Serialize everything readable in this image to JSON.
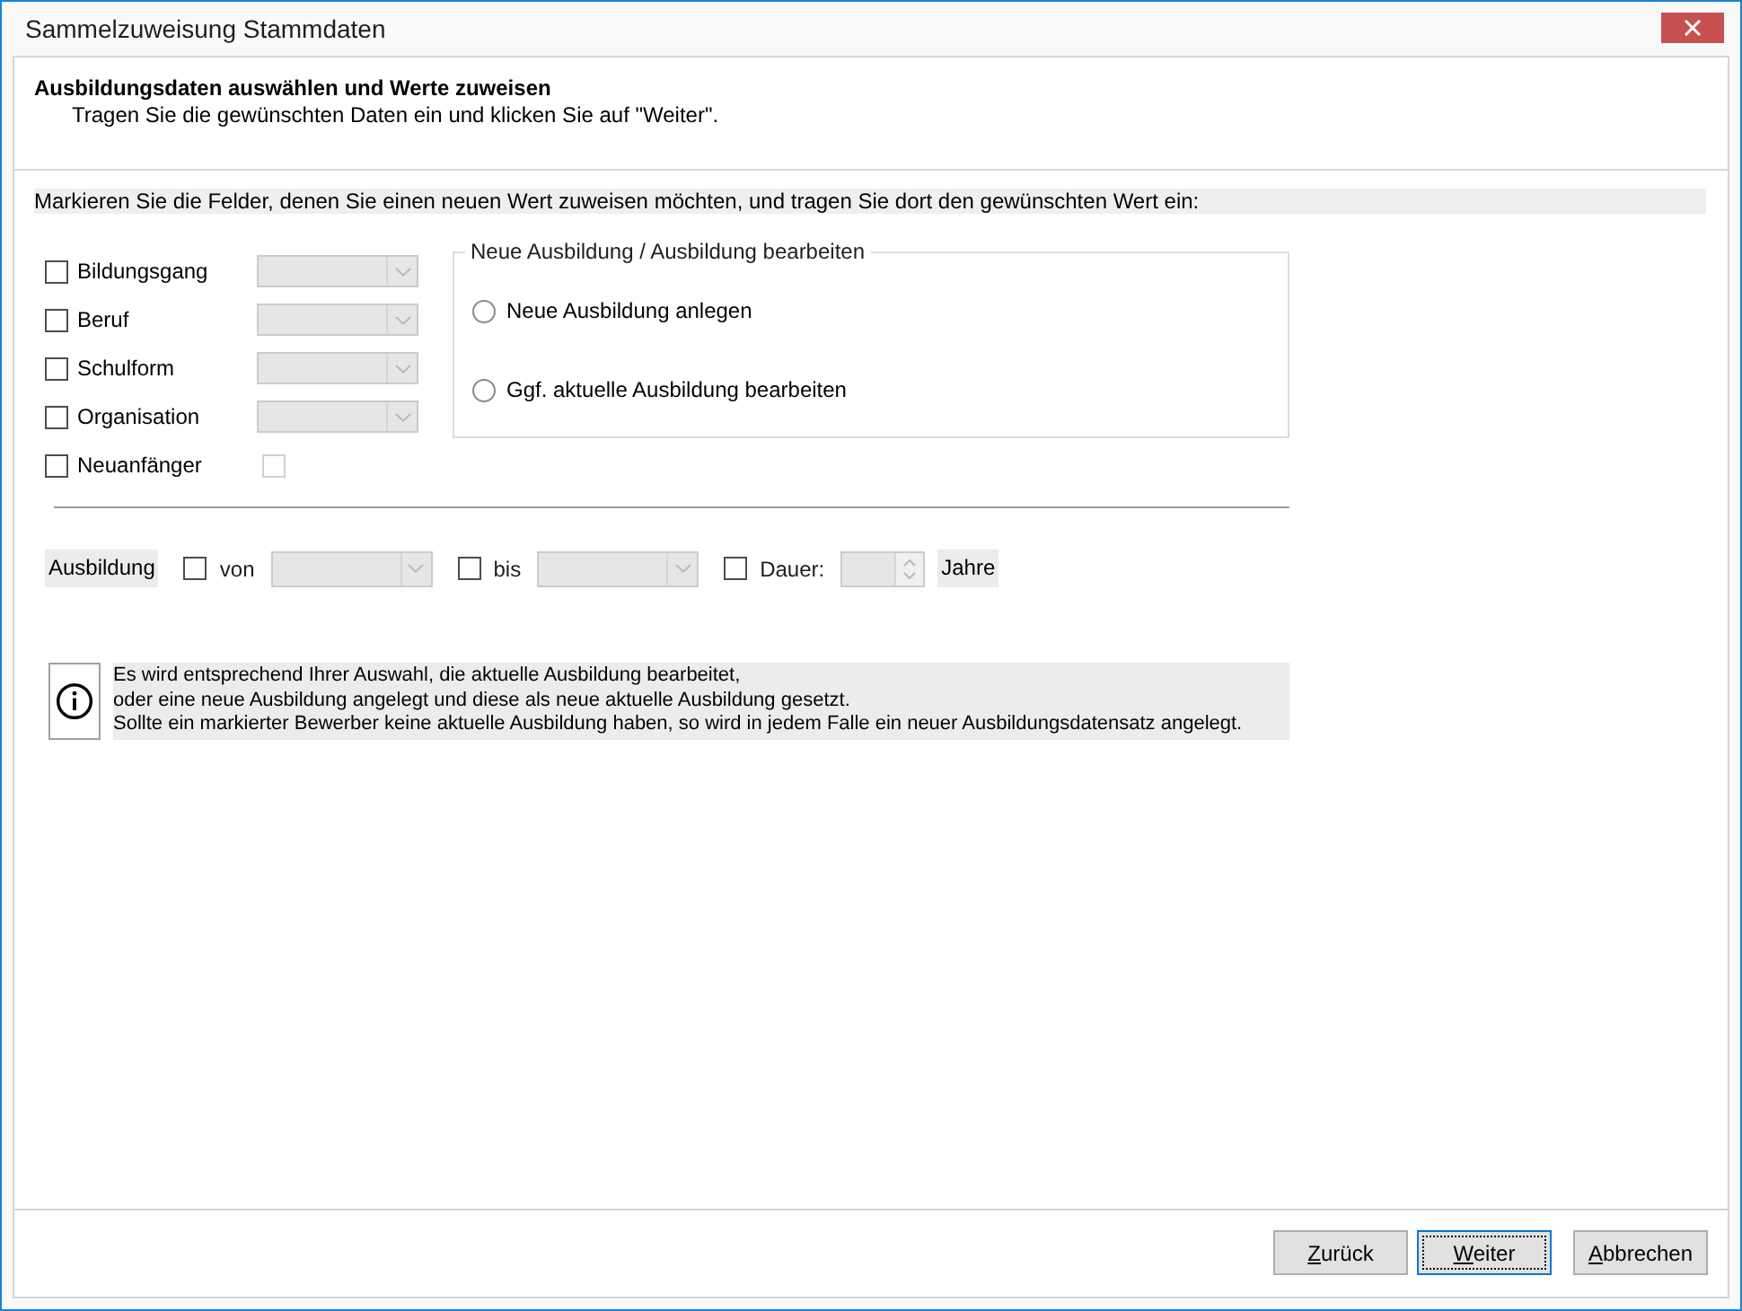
{
  "window": {
    "title": "Sammelzuweisung Stammdaten"
  },
  "header": {
    "title": "Ausbildungsdaten auswählen und Werte zuweisen",
    "subtitle": "Tragen Sie die gewünschten Daten ein und klicken Sie auf \"Weiter\"."
  },
  "instruction": "Markieren Sie die Felder, denen Sie einen neuen Wert zuweisen möchten, und tragen Sie dort den gewünschten Wert ein:",
  "fields": [
    {
      "label": "Bildungsgang",
      "checked": false,
      "kind": "dropdown",
      "input_disabled": true
    },
    {
      "label": "Beruf",
      "checked": false,
      "kind": "dropdown",
      "input_disabled": true
    },
    {
      "label": "Schulform",
      "checked": false,
      "kind": "dropdown",
      "input_disabled": true
    },
    {
      "label": "Organisation",
      "checked": false,
      "kind": "dropdown",
      "input_disabled": true
    },
    {
      "label": "Neuanfänger",
      "checked": false,
      "kind": "checkbox",
      "value_checked": false,
      "input_disabled": true
    }
  ],
  "mode_group": {
    "title": "Neue Ausbildung / Ausbildung bearbeiten",
    "options": [
      {
        "label": "Neue Ausbildung anlegen",
        "selected": false
      },
      {
        "label": "Ggf. aktuelle Ausbildung bearbeiten",
        "selected": false
      }
    ]
  },
  "period": {
    "label": "Ausbildung",
    "items": [
      {
        "kind": "dropdown",
        "label": "von",
        "checked": false,
        "input_disabled": true
      },
      {
        "kind": "dropdown",
        "label": "bis",
        "checked": false,
        "input_disabled": true
      },
      {
        "kind": "spinner",
        "label": "Dauer:",
        "checked": false,
        "input_disabled": true
      }
    ],
    "unit": "Jahre"
  },
  "info": {
    "text": "Es wird entsprechend Ihrer Auswahl, die aktuelle Ausbildung bearbeitet,\noder eine neue Ausbildung angelegt und diese als neue aktuelle Ausbildung gesetzt.\nSollte ein markierter Bewerber keine aktuelle Ausbildung haben, so wird in jedem Falle ein neuer Ausbildungsdatensatz angelegt."
  },
  "buttons": [
    {
      "label": "Zurück",
      "focused": false,
      "mnemonic": true
    },
    {
      "label": "Weiter",
      "focused": true,
      "mnemonic": true
    },
    {
      "label": "Abbrechen",
      "focused": false,
      "mnemonic": true
    }
  ]
}
